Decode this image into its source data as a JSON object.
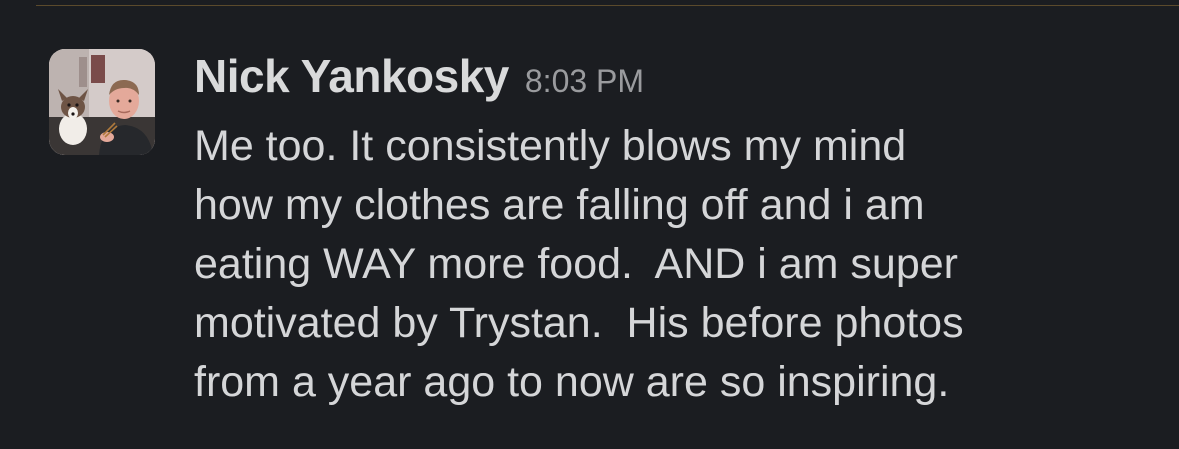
{
  "message": {
    "author": "Nick Yankosky",
    "timestamp": "8:03 PM",
    "avatar_icon": "user-avatar-photo",
    "lines": [
      "Me too. It consistently blows my mind",
      "how my clothes are falling off and i am",
      "eating WAY more food.  AND i am super",
      "motivated by Trystan.  His before photos",
      "from a year ago to now are so inspiring."
    ]
  },
  "colors": {
    "background": "#1b1d21",
    "author": "#d9dadb",
    "timestamp": "#9a9b9e",
    "body_text": "#d5d6d8"
  }
}
